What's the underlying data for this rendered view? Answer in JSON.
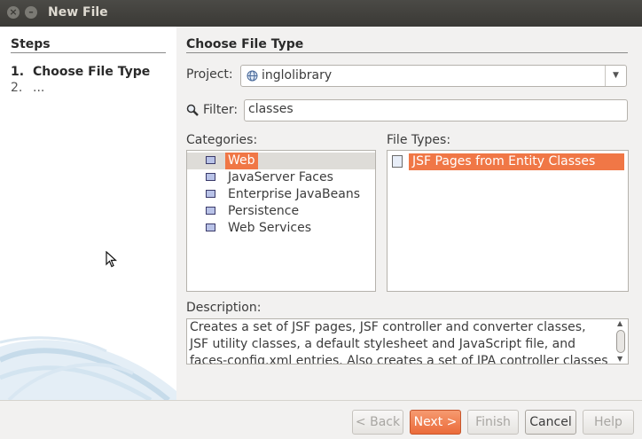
{
  "window": {
    "title": "New File"
  },
  "steps": {
    "heading": "Steps",
    "items": [
      {
        "num": "1.",
        "label": "Choose File Type"
      },
      {
        "num": "2.",
        "label": "..."
      }
    ]
  },
  "main": {
    "title": "Choose File Type",
    "project": {
      "label": "Project:",
      "value": "inglolibrary"
    },
    "filter": {
      "label": "Filter:",
      "value": "classes"
    },
    "categories": {
      "label": "Categories:",
      "items": [
        "Web",
        "JavaServer Faces",
        "Enterprise JavaBeans",
        "Persistence",
        "Web Services"
      ],
      "selected": "Web"
    },
    "file_types": {
      "label": "File Types:",
      "items": [
        "JSF Pages from Entity Classes"
      ],
      "selected": "JSF Pages from Entity Classes"
    },
    "description": {
      "label": "Description:",
      "text": "Creates a set of JSF pages, JSF controller and converter classes, JSF utility classes, a default stylesheet and JavaScript file, and faces-config.xml entries. Also creates a set of JPA controller classes"
    }
  },
  "buttons": {
    "back": "< Back",
    "next": "Next >",
    "finish": "Finish",
    "cancel": "Cancel",
    "help": "Help"
  },
  "colors": {
    "accent": "#f07746",
    "titlebar": "#3c3b37",
    "background": "#f2f1f0"
  }
}
